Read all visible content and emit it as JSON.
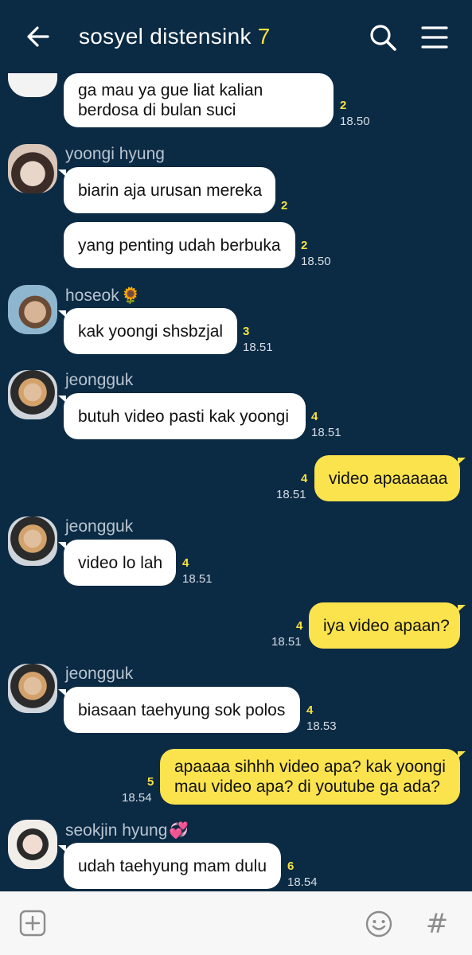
{
  "header": {
    "title": "sosyel distensink",
    "member_count": "7",
    "icons": [
      "back-arrow-icon",
      "search-icon",
      "menu-icon"
    ]
  },
  "messages": [
    {
      "side": "in",
      "text": "ga mau ya gue liat kalian berdosa di bulan suci",
      "unread": "2",
      "time": "18.50"
    },
    {
      "side": "in",
      "sender": "yoongi hyung",
      "text": "biarin aja urusan mereka",
      "unread": "2",
      "time": ""
    },
    {
      "side": "in",
      "text": "yang penting udah berbuka",
      "unread": "2",
      "time": "18.50"
    },
    {
      "side": "in",
      "sender": "hoseok",
      "sender_emoji": "🌻",
      "text": "kak yoongi shsbzjal",
      "unread": "3",
      "time": "18.51"
    },
    {
      "side": "in",
      "sender": "jeongguk",
      "text": "butuh video pasti kak yoongi",
      "unread": "4",
      "time": "18.51"
    },
    {
      "side": "out",
      "text": "video apaaaaaa",
      "unread": "4",
      "time": "18.51"
    },
    {
      "side": "in",
      "sender": "jeongguk",
      "text": "video lo lah",
      "unread": "4",
      "time": "18.51"
    },
    {
      "side": "out",
      "text": "iya video apaan?",
      "unread": "4",
      "time": "18.51"
    },
    {
      "side": "in",
      "sender": "jeongguk",
      "text": "biasaan taehyung sok polos",
      "unread": "4",
      "time": "18.53"
    },
    {
      "side": "out",
      "text": "apaaaa sihhh video apa? kak yoongi mau video apa? di youtube ga ada?",
      "unread": "5",
      "time": "18.54"
    },
    {
      "side": "in",
      "sender": "seokjin hyung",
      "sender_emoji": "💞",
      "text": "udah taehyung mam dulu",
      "unread": "6",
      "time": "18.54"
    }
  ],
  "bottombar": {
    "icons": [
      "add-icon",
      "emoji-icon",
      "hashtag-icon"
    ],
    "hash_glyph": "#"
  },
  "colors": {
    "background": "#0b2a44",
    "incoming_bubble": "#ffffff",
    "outgoing_bubble": "#fbe34d",
    "unread_count": "#f8e23c"
  }
}
